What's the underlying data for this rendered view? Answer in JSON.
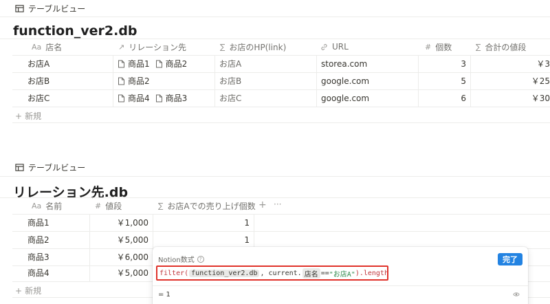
{
  "db1": {
    "view_label": "テーブルビュー",
    "title": "function_ver2.db",
    "headers": [
      {
        "icon": "Aa",
        "label": "店名"
      },
      {
        "icon": "↗",
        "label": "リレーション先"
      },
      {
        "icon": "∑",
        "label": "お店のHP(link)"
      },
      {
        "icon": "🔗",
        "label": "URL"
      },
      {
        "icon": "#",
        "label": "個数"
      },
      {
        "icon": "∑",
        "label": "合計の値段"
      }
    ],
    "rows": [
      {
        "name": "お店A",
        "relations": [
          "商品1",
          "商品2"
        ],
        "hp": "お店A",
        "url": "storea.com",
        "count": "3",
        "total": "￥3"
      },
      {
        "name": "お店B",
        "relations": [
          "商品2"
        ],
        "hp": "お店B",
        "url": "google.com",
        "count": "5",
        "total": "￥25"
      },
      {
        "name": "お店C",
        "relations": [
          "商品4",
          "商品3"
        ],
        "hp": "お店C",
        "url": "google.com",
        "count": "6",
        "total": "￥30"
      }
    ],
    "new_label": "新規"
  },
  "db2": {
    "view_label": "テーブルビュー",
    "title": "リレーション先.db",
    "headers": [
      {
        "icon": "Aa",
        "label": "名前"
      },
      {
        "icon": "#",
        "label": "値段"
      },
      {
        "icon": "∑",
        "label": "お店Aでの売り上げ個数"
      }
    ],
    "rows": [
      {
        "name": "商品1",
        "price": "￥1,000",
        "sales": "1"
      },
      {
        "name": "商品2",
        "price": "￥5,000",
        "sales": "1"
      },
      {
        "name": "商品3",
        "price": "￥6,000",
        "sales": ""
      },
      {
        "name": "商品4",
        "price": "￥5,000",
        "sales": ""
      }
    ],
    "add_col": "+",
    "more": "···",
    "new_label": "新規"
  },
  "formula": {
    "title": "Notion数式",
    "help": "?",
    "done": "完了",
    "tokens": {
      "fn": "filter(",
      "ref1": "function_ver2.db",
      "mid": ", current.",
      "ref2": "店名",
      "op": " == ",
      "str": "\"お店A\"",
      "tail": ").length()"
    },
    "result": "= 1"
  },
  "colors": {
    "accent": "#2383e2",
    "highlight": "#e0322a"
  }
}
